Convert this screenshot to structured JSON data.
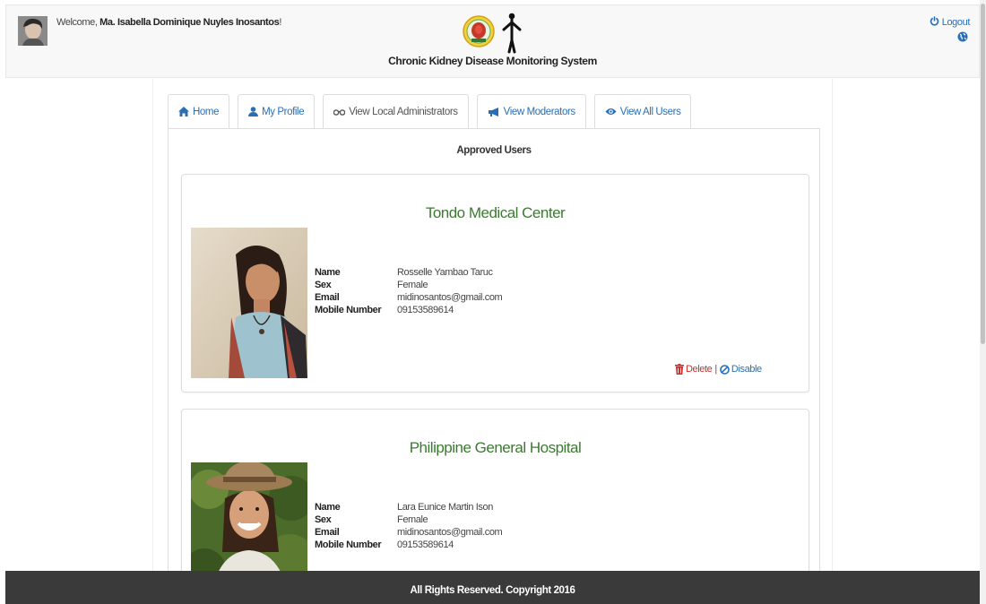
{
  "header": {
    "welcome_prefix": "Welcome, ",
    "user_name": "Ma. Isabella Dominique Nuyles Inosantos",
    "welcome_suffix": "!",
    "system_title": "Chronic Kidney Disease Monitoring System",
    "logout_label": "Logout"
  },
  "tabs": [
    {
      "label": "Home",
      "icon": "home-icon",
      "active": false
    },
    {
      "label": "My Profile",
      "icon": "user-icon",
      "active": false
    },
    {
      "label": "View Local Administrators",
      "icon": "glasses-icon",
      "active": true
    },
    {
      "label": "View Moderators",
      "icon": "bullhorn-icon",
      "active": false
    },
    {
      "label": "View All Users",
      "icon": "eye-icon",
      "active": false
    }
  ],
  "panel": {
    "title": "Approved Users"
  },
  "labels": {
    "name": "Name",
    "sex": "Sex",
    "email": "Email",
    "mobile": "Mobile Number"
  },
  "users": [
    {
      "hospital": "Tondo Medical Center",
      "name": "Rosselle Yambao Taruc",
      "sex": "Female",
      "email": "midinosantos@gmail.com",
      "mobile": "09153589614",
      "delete_label": "Delete",
      "separator": "|",
      "disable_label": "Disable"
    },
    {
      "hospital": "Philippine General Hospital",
      "name": "Lara Eunice Martin Ison",
      "sex": "Female",
      "email": "midinosantos@gmail.com",
      "mobile": "09153589614"
    }
  ],
  "footer": {
    "text": "All Rights Reserved. Copyright 2016"
  },
  "colors": {
    "link": "#2a6fb5",
    "hospital_title": "#3c7a32",
    "delete": "#c9302c",
    "footer_bg": "#3a3a3a"
  }
}
